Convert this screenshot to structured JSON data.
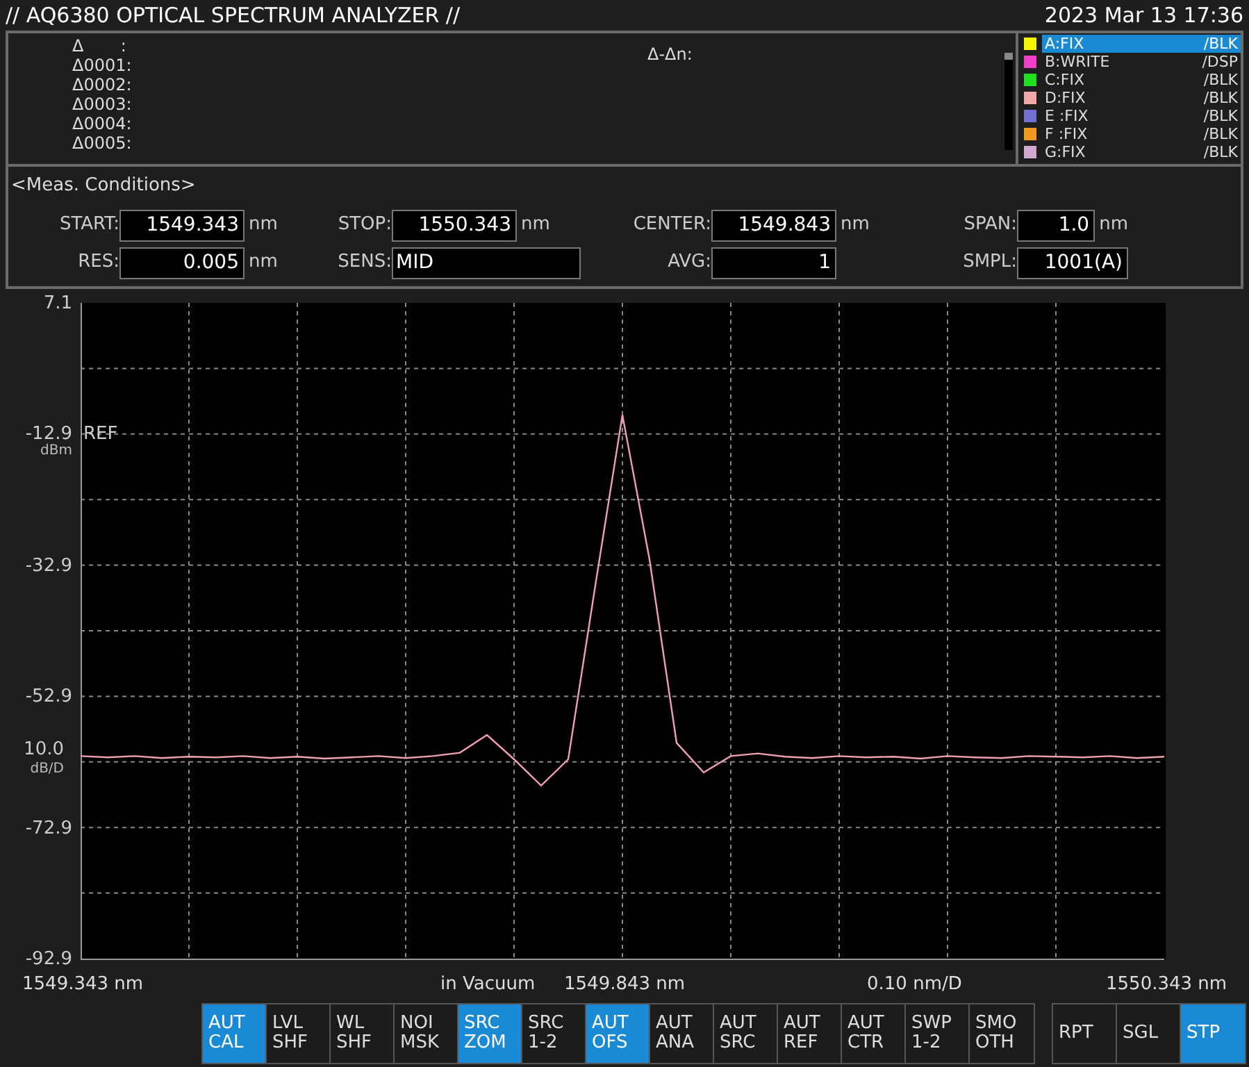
{
  "window": {
    "title": "// AQ6380 OPTICAL SPECTRUM ANALYZER //",
    "datetime": "2023 Mar 13 17:36"
  },
  "markers": {
    "rows": [
      "Δ       :",
      "Δ0001:",
      "Δ0002:",
      "Δ0003:",
      "Δ0004:",
      "Δ0005:"
    ],
    "delta_label": "Δ-Δn:"
  },
  "traces": [
    {
      "name": "A:FIX",
      "mode": "/BLK",
      "color": "#f5f500",
      "selected": true
    },
    {
      "name": "B:WRITE",
      "mode": "/DSP",
      "color": "#f040c8",
      "selected": false
    },
    {
      "name": "C:FIX",
      "mode": "/BLK",
      "color": "#20e020",
      "selected": false
    },
    {
      "name": "D:FIX",
      "mode": "/BLK",
      "color": "#f0a8a8",
      "selected": false
    },
    {
      "name": "E :FIX",
      "mode": "/BLK",
      "color": "#7070d0",
      "selected": false
    },
    {
      "name": "F :FIX",
      "mode": "/BLK",
      "color": "#f09820",
      "selected": false
    },
    {
      "name": "G:FIX",
      "mode": "/BLK",
      "color": "#d0a8d0",
      "selected": false
    }
  ],
  "conditions": {
    "title": "<Meas. Conditions>",
    "rows": [
      [
        {
          "label": "START:",
          "value": "1549.343",
          "unit": "nm",
          "kind": "number"
        },
        {
          "label": "STOP:",
          "value": "1550.343",
          "unit": "nm",
          "kind": "number"
        },
        {
          "label": "CENTER:",
          "value": "1549.843",
          "unit": "nm",
          "kind": "number"
        },
        {
          "label": "SPAN:",
          "value": "1.0",
          "unit": "nm",
          "kind": "number"
        }
      ],
      [
        {
          "label": "RES:",
          "value": "0.005",
          "unit": "nm",
          "kind": "number"
        },
        {
          "label": "SENS:",
          "value": "MID",
          "kind": "text"
        },
        {
          "label": "AVG:",
          "value": "1",
          "kind": "number"
        },
        {
          "label": "SMPL:",
          "value": "1001(A)",
          "kind": "number"
        }
      ]
    ]
  },
  "display": {
    "ref_label": "REF",
    "ref_unit": "dBm",
    "scale_value": "10.0",
    "scale_unit": "dB/D",
    "medium": "in Vacuum",
    "per_div": "0.10 nm/D",
    "chart_data": {
      "type": "line",
      "grid": true,
      "xlim": [
        1549.343,
        1550.343
      ],
      "ylim": [
        -92.9,
        7.1
      ],
      "xticks": [
        {
          "value": 1549.343,
          "label": "1549.343 nm"
        },
        {
          "value": 1549.843,
          "label": "1549.843 nm"
        },
        {
          "value": 1550.343,
          "label": "1550.343 nm"
        }
      ],
      "yticks": [
        7.1,
        -12.9,
        -32.9,
        -52.9,
        -72.9,
        -92.9
      ],
      "x": [
        1549.343,
        1549.368,
        1549.393,
        1549.418,
        1549.443,
        1549.468,
        1549.493,
        1549.518,
        1549.543,
        1549.568,
        1549.593,
        1549.618,
        1549.643,
        1549.668,
        1549.693,
        1549.718,
        1549.743,
        1549.768,
        1549.793,
        1549.818,
        1549.843,
        1549.868,
        1549.893,
        1549.918,
        1549.943,
        1549.968,
        1549.993,
        1550.018,
        1550.043,
        1550.068,
        1550.093,
        1550.118,
        1550.143,
        1550.168,
        1550.193,
        1550.218,
        1550.243,
        1550.268,
        1550.293,
        1550.318,
        1550.343
      ],
      "series": [
        {
          "color": "#f0a0b0",
          "values": [
            -62.0,
            -62.2,
            -62.0,
            -62.3,
            -62.1,
            -62.2,
            -62.0,
            -62.3,
            -62.1,
            -62.4,
            -62.2,
            -62.0,
            -62.3,
            -62.0,
            -61.5,
            -58.8,
            -62.5,
            -66.5,
            -62.5,
            -36.0,
            -10.0,
            -32.0,
            -60.0,
            -64.5,
            -62.0,
            -61.6,
            -62.1,
            -62.3,
            -62.0,
            -62.2,
            -62.1,
            -62.4,
            -62.0,
            -62.2,
            -62.3,
            -62.0,
            -62.1,
            -62.2,
            -62.0,
            -62.3,
            -62.1
          ]
        }
      ]
    }
  },
  "soft_keys": [
    {
      "label": "AUT\nCAL",
      "selected": true
    },
    {
      "label": "LVL\nSHF",
      "selected": false
    },
    {
      "label": "WL\nSHF",
      "selected": false
    },
    {
      "label": "NOI\nMSK",
      "selected": false
    },
    {
      "label": "SRC\nZOM",
      "selected": true
    },
    {
      "label": "SRC\n1-2",
      "selected": false
    },
    {
      "label": "AUT\nOFS",
      "selected": true
    },
    {
      "label": "AUT\nANA",
      "selected": false
    },
    {
      "label": "AUT\nSRC",
      "selected": false
    },
    {
      "label": "AUT\nREF",
      "selected": false
    },
    {
      "label": "AUT\nCTR",
      "selected": false
    },
    {
      "label": "SWP\n1-2",
      "selected": false
    },
    {
      "label": "SMO\nOTH",
      "selected": false
    }
  ],
  "sweep_keys": [
    {
      "label": "RPT",
      "selected": false
    },
    {
      "label": "SGL",
      "selected": false
    },
    {
      "label": "STP",
      "selected": true
    }
  ]
}
